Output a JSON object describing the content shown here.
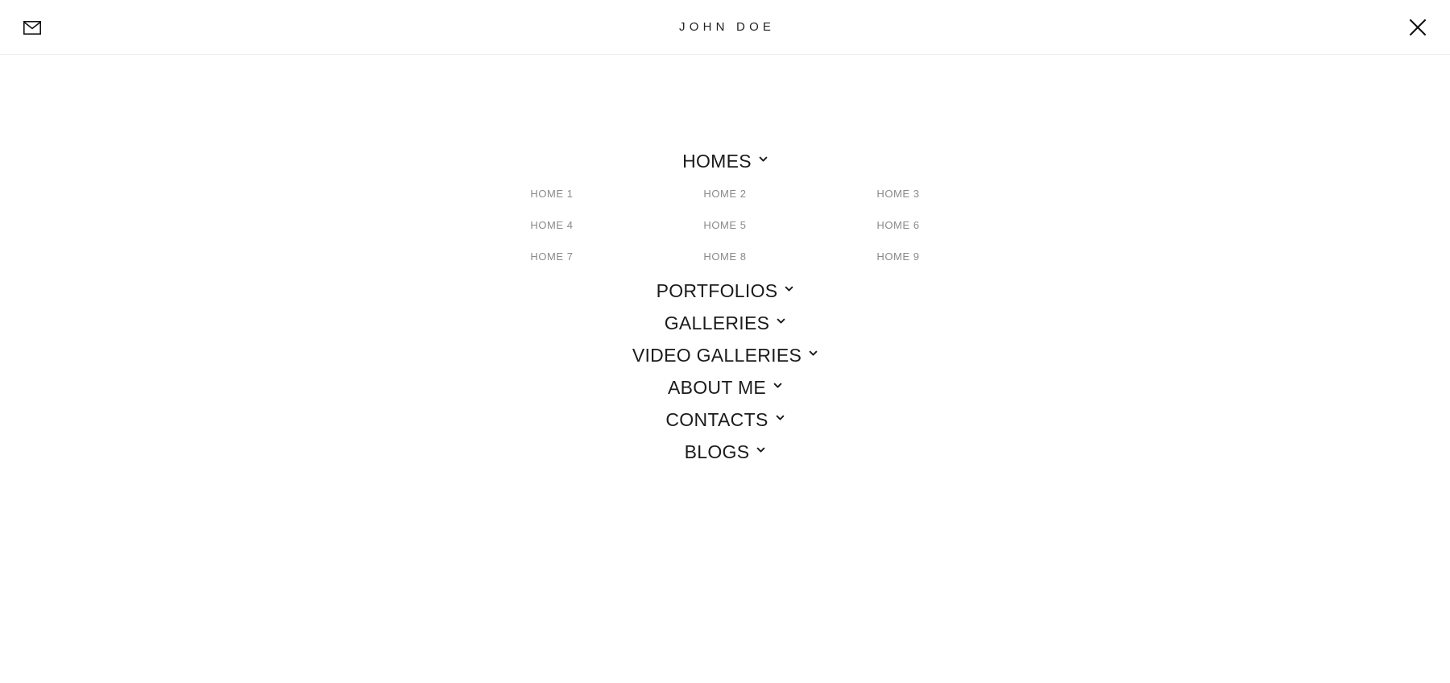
{
  "header": {
    "mail_icon": "envelope-icon",
    "mail_label": "Email",
    "brand": "JOHN DOE",
    "close_icon": "close-icon",
    "close_label": "Close menu"
  },
  "colors": {
    "background": "#ffffff",
    "primary_text": "#1b1b1b",
    "brand_text": "#232323",
    "submenu_text": "#8a8a8a",
    "divider": "#eeeeee"
  },
  "menu": {
    "items": [
      {
        "label": "HOMES",
        "chevron": "chevron-down-icon",
        "expanded": true,
        "submenu": [
          "HOME 1",
          "HOME 2",
          "HOME 3",
          "HOME 4",
          "HOME 5",
          "HOME 6",
          "HOME 7",
          "HOME 8",
          "HOME 9"
        ]
      },
      {
        "label": "PORTFOLIOS",
        "chevron": "chevron-down-icon",
        "expanded": false,
        "submenu": []
      },
      {
        "label": "GALLERIES",
        "chevron": "chevron-down-icon",
        "expanded": false,
        "submenu": []
      },
      {
        "label": "VIDEO GALLERIES",
        "chevron": "chevron-down-icon",
        "expanded": false,
        "submenu": []
      },
      {
        "label": "ABOUT ME",
        "chevron": "chevron-down-icon",
        "expanded": false,
        "submenu": []
      },
      {
        "label": "CONTACTS",
        "chevron": "chevron-down-icon",
        "expanded": false,
        "submenu": []
      },
      {
        "label": "BLOGS",
        "chevron": "chevron-down-icon",
        "expanded": false,
        "submenu": []
      }
    ]
  }
}
